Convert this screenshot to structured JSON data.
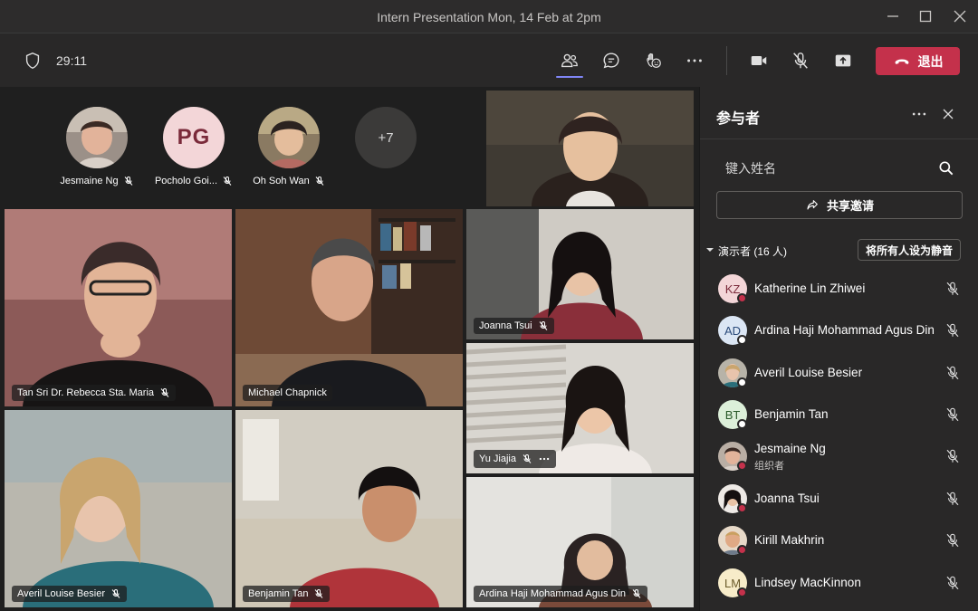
{
  "window": {
    "title": "Intern Presentation Mon, 14 Feb at 2pm"
  },
  "toolbar": {
    "timer": "29:11",
    "leave_label": "退出",
    "icons": [
      "shield-icon",
      "people-icon",
      "chat-icon",
      "reactions-icon",
      "more-icon",
      "camera-icon",
      "mic-off-icon",
      "share-tray-icon",
      "phone-icon"
    ]
  },
  "strip": {
    "people": [
      {
        "name": "Jesmaine Ng"
      },
      {
        "name": "Pocholo Goi...",
        "initials": "PG"
      },
      {
        "name": "Oh Soh Wan"
      }
    ],
    "more_count": "+7"
  },
  "tiles": [
    {
      "name": "Tan Sri Dr. Rebecca Sta. Maria"
    },
    {
      "name": "Michael Chapnick"
    },
    {
      "name": "Joanna Tsui"
    },
    {
      "name": "Yu Jiajia"
    },
    {
      "name": "Averil Louise Besier"
    },
    {
      "name": "Benjamin Tan"
    },
    {
      "name": "Ardina Haji Mohammad Agus Din"
    }
  ],
  "panel": {
    "title": "参与者",
    "search_placeholder": "键入姓名",
    "share_label": "共享邀请",
    "section_label": "演示者 (16 人)",
    "mute_all_label": "将所有人设为静音",
    "participants": [
      {
        "name": "Katherine Lin Zhiwei",
        "initials": "KZ",
        "role": ""
      },
      {
        "name": "Ardina Haji Mohammad Agus Din",
        "initials": "AD",
        "role": ""
      },
      {
        "name": "Averil Louise Besier",
        "initials": "",
        "role": ""
      },
      {
        "name": "Benjamin Tan",
        "initials": "BT",
        "role": ""
      },
      {
        "name": "Jesmaine Ng",
        "initials": "",
        "role": "组织者"
      },
      {
        "name": "Joanna Tsui",
        "initials": "",
        "role": ""
      },
      {
        "name": "Kirill Makhrin",
        "initials": "",
        "role": ""
      },
      {
        "name": "Lindsey MacKinnon",
        "initials": "LM",
        "role": ""
      }
    ]
  },
  "colors": {
    "accent": "#7f85f5",
    "leave": "#c4314b",
    "status_red": "#c4314b"
  }
}
